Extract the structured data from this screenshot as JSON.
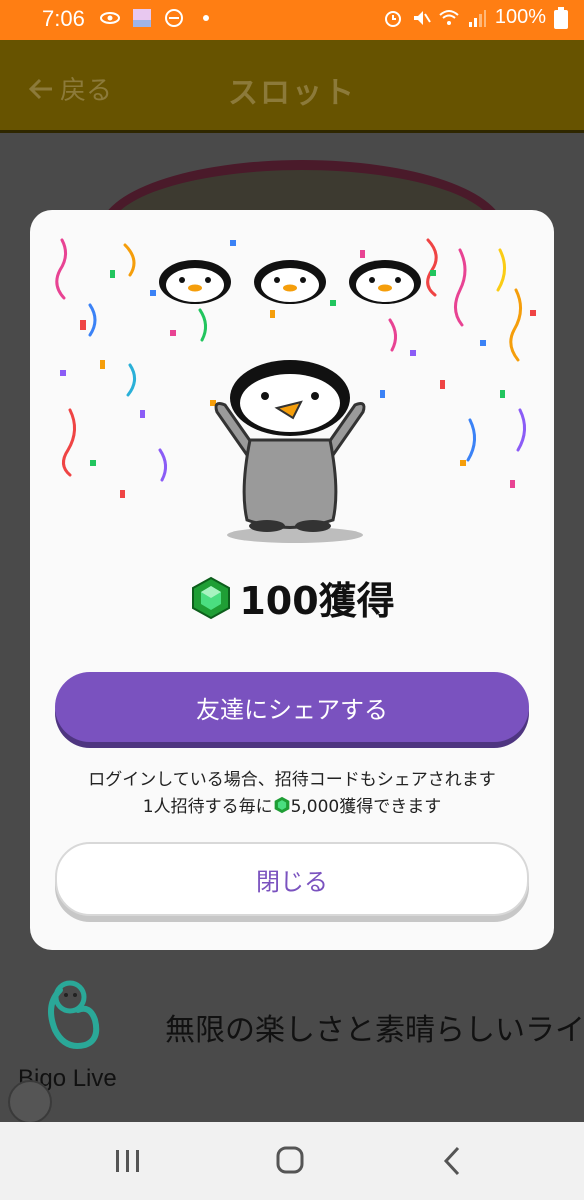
{
  "status_bar": {
    "time": "7:06",
    "battery": "100%",
    "icons": [
      "eye-icon",
      "app-thumbnail-icon",
      "do-not-disturb-icon",
      "dot-icon",
      "alarm-icon",
      "mute-icon",
      "wifi-icon",
      "signal-icon",
      "battery-icon"
    ]
  },
  "app_bar": {
    "back_label": "戻る",
    "title": "スロット"
  },
  "dialog": {
    "reward_amount": "100獲得",
    "reward_icon": "green-gem-icon",
    "share_button": "友達にシェアする",
    "info_line1": "ログインしている場合、招待コードもシェアされます",
    "info_line2_prefix": "1人招待する毎に",
    "info_line2_suffix": "5,000獲得できます",
    "close_button": "閉じる"
  },
  "background": {
    "app_name": "Bigo Live",
    "tagline": "無限の楽しさと素晴らしいライ"
  },
  "colors": {
    "status_bar": "#ff7e13",
    "app_bar": "#675300",
    "accent_purple": "#7a52bf",
    "gem_green": "#2ecc40"
  },
  "nav_bar": {
    "icons": [
      "recent-apps-icon",
      "home-icon",
      "back-icon"
    ]
  }
}
